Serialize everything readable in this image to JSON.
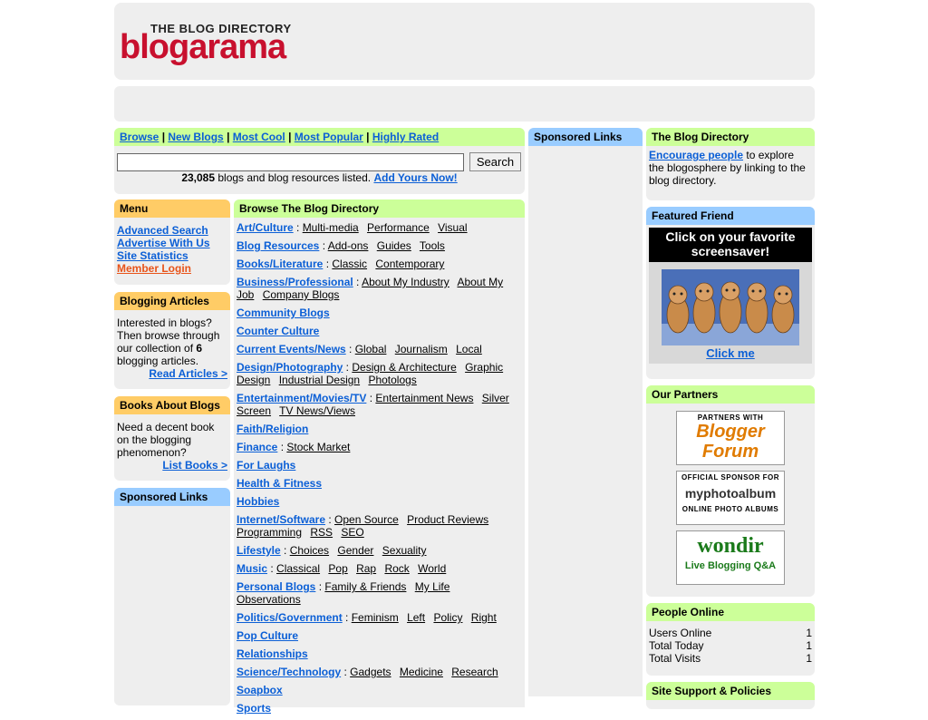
{
  "header": {
    "logo_small": "THE BLOG DIRECTORY",
    "logo_big": "blogarama"
  },
  "nav": {
    "links": [
      "Browse",
      "New Blogs",
      "Most Cool",
      "Most Popular",
      "Highly Rated"
    ],
    "search_button": "Search",
    "search_value": "",
    "stats_count": "23,085",
    "stats_text": " blogs and blog resources listed. ",
    "add_yours": "Add Yours Now!"
  },
  "menu": {
    "title": "Menu",
    "items": [
      "Advanced Search",
      "Advertise With Us",
      "Site Statistics",
      "Member Login"
    ]
  },
  "articles": {
    "title": "Blogging Articles",
    "text_before": "Interested in blogs? Then browse through our collection of ",
    "count": "6",
    "text_after": " blogging articles.",
    "link": "Read Articles >"
  },
  "books": {
    "title": "Books About Blogs",
    "text": "Need a decent book on the blogging phenomenon?",
    "link": "List Books >"
  },
  "sponsored_left": {
    "title": "Sponsored Links"
  },
  "sponsored_mid": {
    "title": "Sponsored Links"
  },
  "browse": {
    "title": "Browse The Blog Directory",
    "categories": [
      {
        "name": "Art/Culture",
        "subs": [
          "Multi-media",
          "Performance",
          "Visual"
        ]
      },
      {
        "name": "Blog Resources",
        "subs": [
          "Add-ons",
          "Guides",
          "Tools"
        ]
      },
      {
        "name": "Books/Literature",
        "subs": [
          "Classic",
          "Contemporary"
        ]
      },
      {
        "name": "Business/Professional",
        "subs": [
          "About My Industry",
          "About My Job",
          "Company Blogs"
        ]
      },
      {
        "name": "Community Blogs",
        "subs": []
      },
      {
        "name": "Counter Culture",
        "subs": []
      },
      {
        "name": "Current Events/News",
        "subs": [
          "Global",
          "Journalism",
          "Local"
        ]
      },
      {
        "name": "Design/Photography",
        "subs": [
          "Design & Architecture",
          "Graphic Design",
          "Industrial Design",
          "Photologs"
        ]
      },
      {
        "name": "Entertainment/Movies/TV",
        "subs": [
          "Entertainment News",
          "Silver Screen",
          "TV News/Views"
        ]
      },
      {
        "name": "Faith/Religion",
        "subs": []
      },
      {
        "name": "Finance",
        "subs": [
          "Stock Market"
        ]
      },
      {
        "name": "For Laughs",
        "subs": []
      },
      {
        "name": "Health & Fitness",
        "subs": []
      },
      {
        "name": "Hobbies",
        "subs": []
      },
      {
        "name": "Internet/Software",
        "subs": [
          "Open Source",
          "Product Reviews",
          "Programming",
          "RSS",
          "SEO"
        ]
      },
      {
        "name": "Lifestyle",
        "subs": [
          "Choices",
          "Gender",
          "Sexuality"
        ]
      },
      {
        "name": "Music",
        "subs": [
          "Classical",
          "Pop",
          "Rap",
          "Rock",
          "World"
        ]
      },
      {
        "name": "Personal Blogs",
        "subs": [
          "Family & Friends",
          "My Life",
          "Observations"
        ]
      },
      {
        "name": "Politics/Government",
        "subs": [
          "Feminism",
          "Left",
          "Policy",
          "Right"
        ]
      },
      {
        "name": "Pop Culture",
        "subs": []
      },
      {
        "name": "Relationships",
        "subs": []
      },
      {
        "name": "Science/Technology",
        "subs": [
          "Gadgets",
          "Medicine",
          "Research"
        ]
      },
      {
        "name": "Soapbox",
        "subs": []
      },
      {
        "name": "Sports",
        "subs": []
      }
    ]
  },
  "directory": {
    "title": "The Blog Directory",
    "link": "Encourage people",
    "text": " to explore the blogosphere by linking to the blog directory."
  },
  "featured": {
    "title": "Featured Friend",
    "banner": "Click on your favorite screensaver!",
    "click": "Click me"
  },
  "partners": {
    "title": "Our Partners",
    "items": [
      {
        "top": "PARTNERS WITH",
        "main": "Blogger Forum",
        "bottom": ""
      },
      {
        "top": "OFFICIAL SPONSOR FOR",
        "main": "myphotoalbum",
        "bottom": "ONLINE PHOTO ALBUMS"
      },
      {
        "top": "",
        "main": "wondir",
        "bottom": "Live Blogging Q&A"
      }
    ]
  },
  "people": {
    "title": "People Online",
    "rows": [
      {
        "label": "Users Online",
        "value": "1"
      },
      {
        "label": "Total Today",
        "value": "1"
      },
      {
        "label": "Total Visits",
        "value": "1"
      }
    ]
  },
  "support": {
    "title": "Site Support & Policies"
  },
  "colors": {
    "link": "#0b5fd6",
    "green_header": "#ccff99",
    "orange_header": "#ffcc66",
    "blue_header": "#99ccff",
    "box_bg": "#eeeeee",
    "member_login": "#e8541a"
  }
}
